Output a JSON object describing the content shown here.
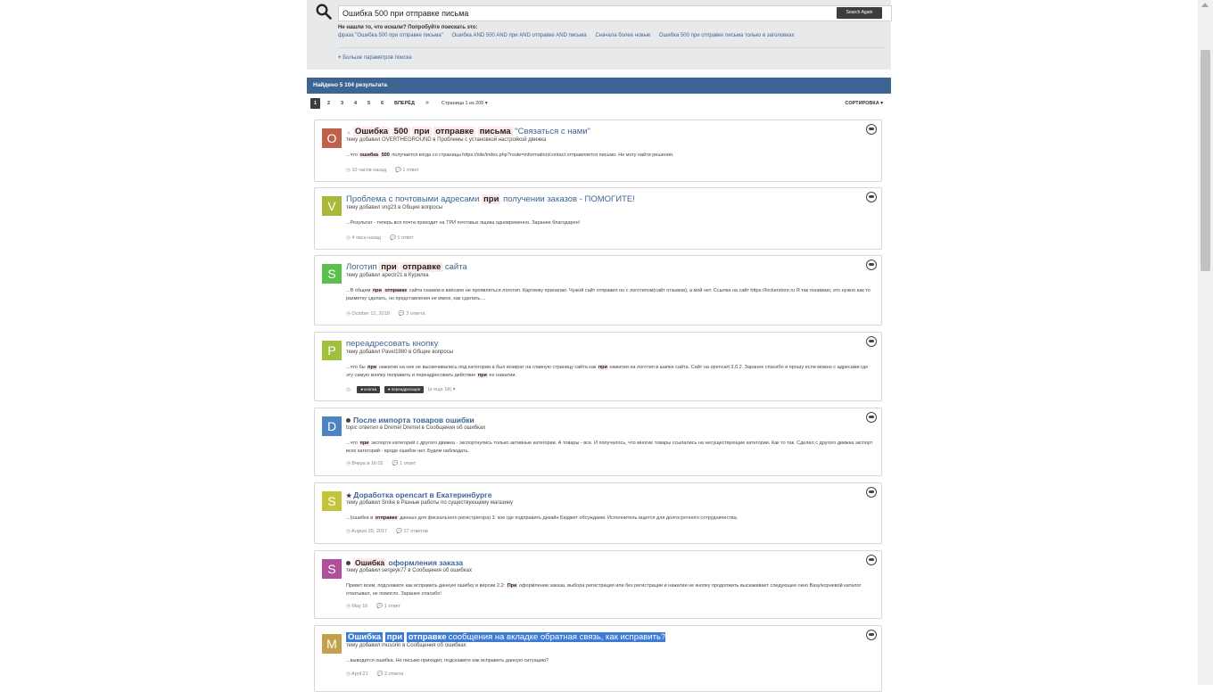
{
  "search": {
    "query": "Ошибка 500 при отправке письма",
    "button_label": "Search Again",
    "not_found_text": "Не нашли то, что искали? Попробуйте поискать это:",
    "suggestions": [
      "фраза \"Ошибка 500 при отправке письма\"",
      "Ошибка AND 500 AND при AND отправке AND письма",
      "Сначала более новые",
      "Ошибка 500 при отправке письма только в заголовках"
    ],
    "more_params": "Больше параметров поиска"
  },
  "results": {
    "found_text": "Найдено 5 104 результата",
    "pages": [
      "1",
      "2",
      "3",
      "4",
      "5",
      "6"
    ],
    "next_label": "ВПЕРЁД",
    "last_label": "»",
    "page_of": "Страница 1 из 205 ▾",
    "sort_label": "СОРТИРОВКА ▾"
  },
  "colors": {
    "accent": "#3d6594",
    "highlight": "#fde9e9",
    "selection": "#3d7bd6"
  },
  "cards": [
    {
      "avatar_letter": "O",
      "avatar_color": "#c0604c",
      "title_hl1": "Ошибка",
      "title_hl2": "500",
      "title_hl3": "при",
      "title_hl4": "отправке",
      "title_hl5": "письма",
      "title_rest": "\"Связаться с нами\"",
      "meta": "тему добавил OVERTHEGROUND в Проблемы с установкой настройкой движка",
      "snippet_pre": "...что",
      "snippet_hl1": "ошибка",
      "snippet_hl2": "500",
      "snippet_post": "получается когда со страницы https://site/index.php?route=information/contact отправляется письмо. Не могу найти решения.",
      "stat1": "◷ 10 часов назад",
      "stat2": "💬 1 ответ"
    },
    {
      "avatar_letter": "V",
      "avatar_color": "#aab83a",
      "title_pre": "Проблема с почтовыми адресами",
      "title_hl": "при",
      "title_post": "получении заказов - ПОМОГИТЕ!",
      "meta": "тему добавил vng23 в Общие вопросы",
      "snippet": "...Результат - теперь вся почта приходит на ТРИ почтовых ящика одновременно. Заранее благодарен!",
      "stat1": "◷ 4 часа назад",
      "stat2": "💬 1 ответ"
    },
    {
      "avatar_letter": "S",
      "avatar_color": "#5bbf4e",
      "title_pre": "Логотип",
      "title_hl1": "при",
      "title_hl2": "отправке",
      "title_post": "сайта",
      "meta": "тему добавил apectr21 в Курилка",
      "snippet_pre": "...В общем",
      "snippet_hl1": "при",
      "snippet_hl2": "отправке",
      "snippet_post": "сайта скажем в вапсапе не проявляться логотип. Картинку прилагаю. Чужой сайт отправил он с логотипом(сайт отзывов), а мой нет. Ссылка на сайт https://lockerstore.ru Я так понимаю, это нужно как то разметку сделать, но представления не имею, как сделать....",
      "stat1": "◷ October 12, 2018",
      "stat2": "💬 3 ответа"
    },
    {
      "avatar_letter": "P",
      "avatar_color": "#9fc03c",
      "title": "переадресовать кнопку",
      "meta": "тему добавил Pavel1980 в Общие вопросы",
      "snippet_pre": "...что бы",
      "snippet_hl1": "при",
      "snippet_mid1": "нажатии на нее не высвечивались под категории а был возврат на главную страницу сайта как",
      "snippet_hl2": "при",
      "snippet_mid2": "нажатии на логотип в шапке сайта. Сайт на opencart 3.0.2. Заранее спасибо и прошу если можно с адресами где эту самую кнопку поправить и переадресовать действие",
      "snippet_hl3": "при",
      "snippet_post": "ее нажатии.",
      "stat1": "◷",
      "tag1": "● кнопка",
      "tag2": "● переадресация",
      "tag_more": "(и еще 1й) ▾"
    },
    {
      "avatar_letter": "D",
      "avatar_color": "#4f84c4",
      "title": "После импорта товаров ошибки",
      "meta": "topic ответил в Dremel Dremel в Сообщения об ошибках",
      "snippet_pre": "...что",
      "snippet_hl1": "при",
      "snippet_post": "экспорте категорий с другого движка - экспортнулись только активные категории. А товары - все. И получалось, что многие товары ссылались на несуществующие категории. Как то так. Сделал с другого движка экспорт всех категорий - вроде ошибок нет. Будем наблюдать.",
      "stat1": "◷ Вчера в 16:02",
      "stat2": "💬 1 ответ"
    },
    {
      "avatar_letter": "S",
      "avatar_color": "#c4c43a",
      "title": "Доработка opencart в Екатеринбурге",
      "meta": "тему добавил Snike в Разные работы по существующему магазину",
      "snippet_pre": "...(ошибка в",
      "snippet_hl1": "отправке",
      "snippet_post": "данных для фискального регистратора) 3. кое где подправить дизайн Бюджет обсуждаем. Исполнитель ищется для долгосрочного сотрудничества.",
      "stat1": "◷ August 30, 2017",
      "stat2": "💬 17 ответов"
    },
    {
      "avatar_letter": "S",
      "avatar_color": "#b0509c",
      "title_hl": "Ошибка",
      "title_post": "оформления заказа",
      "meta": "тему добавил sergeyk77 в Сообщения об ошибках",
      "snippet_pre": "Привет всем, подскажите как исправить данную ошибку в версии 2.2:",
      "snippet_hl1": "При",
      "snippet_post": "оформлении заказа, выбора регистрация или без регистрации и нажатии не кнопку продолжить выскакивает следующее окно Вазу/корневой каталог откатывал, не помогло. Заранее спасибо!",
      "stat1": "◷ May 16",
      "stat2": "💬 1 ответ"
    },
    {
      "avatar_letter": "M",
      "avatar_color": "#c4a04c",
      "title_hl1": "Ошибка",
      "title_hl2": "при",
      "title_hl3": "отправке",
      "title_post": "сообщения на вкладке обратная связь, как исправить?",
      "meta": "тему добавил musorin в Сообщения об ошибках",
      "snippet": "...выводится ошибка. Но письмо приходит, подскажите как исправить данную ситуацию?",
      "stat1": "◷ April 21",
      "stat2": "💬 2 ответа"
    }
  ]
}
